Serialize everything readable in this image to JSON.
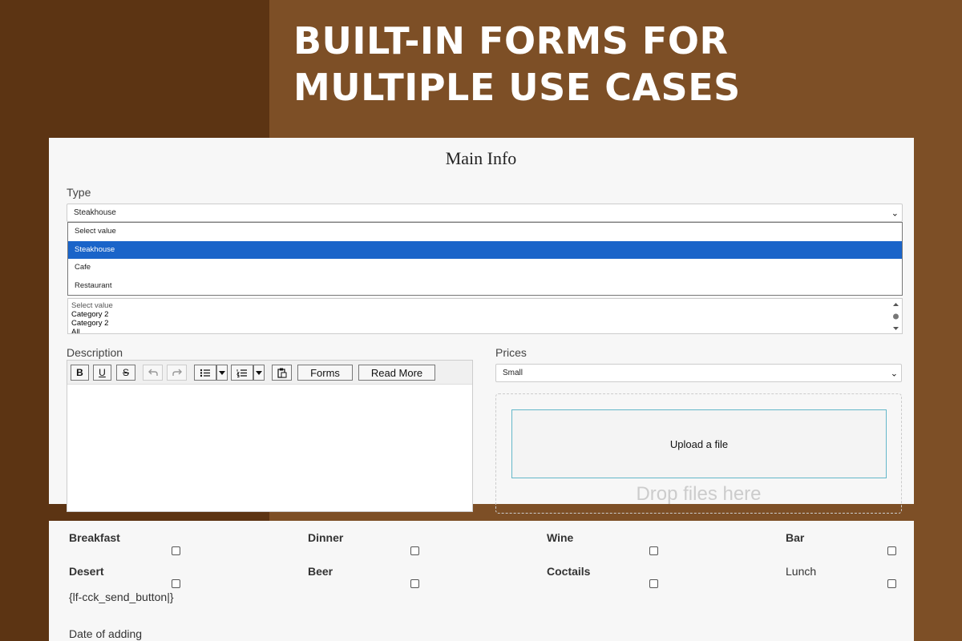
{
  "headline": "BUILT-IN FORMS FOR\nMULTIPLE USE CASES",
  "main_info": {
    "title": "Main Info",
    "type_label": "Type",
    "type_value": "Steakhouse",
    "type_options": [
      "Select value",
      "Steakhouse",
      "Cafe",
      "Restaurant"
    ],
    "type_selected_index": 1,
    "category_list": [
      "Select value",
      "Category 2",
      "Category 2",
      "All"
    ],
    "description_label": "Description",
    "prices_label": "Prices",
    "prices_value": "Small",
    "toolbar": {
      "bold": "B",
      "underline": "U",
      "strike": "S",
      "forms": "Forms",
      "read_more": "Read More"
    },
    "upload_label": "Upload a file",
    "drop_label": "Drop files here"
  },
  "options_form": {
    "checkboxes": [
      {
        "label": "Breakfast",
        "bold": true
      },
      {
        "label": "Dinner",
        "bold": true
      },
      {
        "label": "Wine",
        "bold": true
      },
      {
        "label": "Bar",
        "bold": true
      },
      {
        "label": "Desert",
        "bold": true
      },
      {
        "label": "Beer",
        "bold": true
      },
      {
        "label": "Coctails",
        "bold": true
      },
      {
        "label": "Lunch",
        "bold": false
      }
    ],
    "send_placeholder": "{lf-cck_send_button|}",
    "date_label": "Date of adding"
  },
  "colors": {
    "bg_dark": "#5c3413",
    "bg_light": "#7d4f26",
    "highlight": "#1a64c9"
  }
}
